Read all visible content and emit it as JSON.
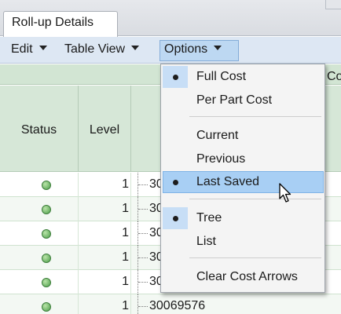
{
  "tab": {
    "label": "Roll-up Details"
  },
  "menubar": {
    "edit": "Edit",
    "table_view": "Table View",
    "options": "Options"
  },
  "columns": {
    "status": "Status",
    "level": "Level",
    "cost_partial": "Co"
  },
  "rows": [
    {
      "level": "1",
      "part": "30"
    },
    {
      "level": "1",
      "part": "30"
    },
    {
      "level": "1",
      "part": "30"
    },
    {
      "level": "1",
      "part": "30"
    },
    {
      "level": "1",
      "part": "30"
    },
    {
      "level": "1",
      "part": "30069576"
    }
  ],
  "options_menu": {
    "full_cost": "Full Cost",
    "per_part_cost": "Per Part Cost",
    "current": "Current",
    "previous": "Previous",
    "last_saved": "Last Saved",
    "tree": "Tree",
    "list": "List",
    "clear_cost_arrows": "Clear Cost Arrows"
  },
  "colors": {
    "header_green": "#d6e7d7",
    "menu_highlight": "#a8cff4",
    "menubar_blue": "#dde7f3"
  }
}
